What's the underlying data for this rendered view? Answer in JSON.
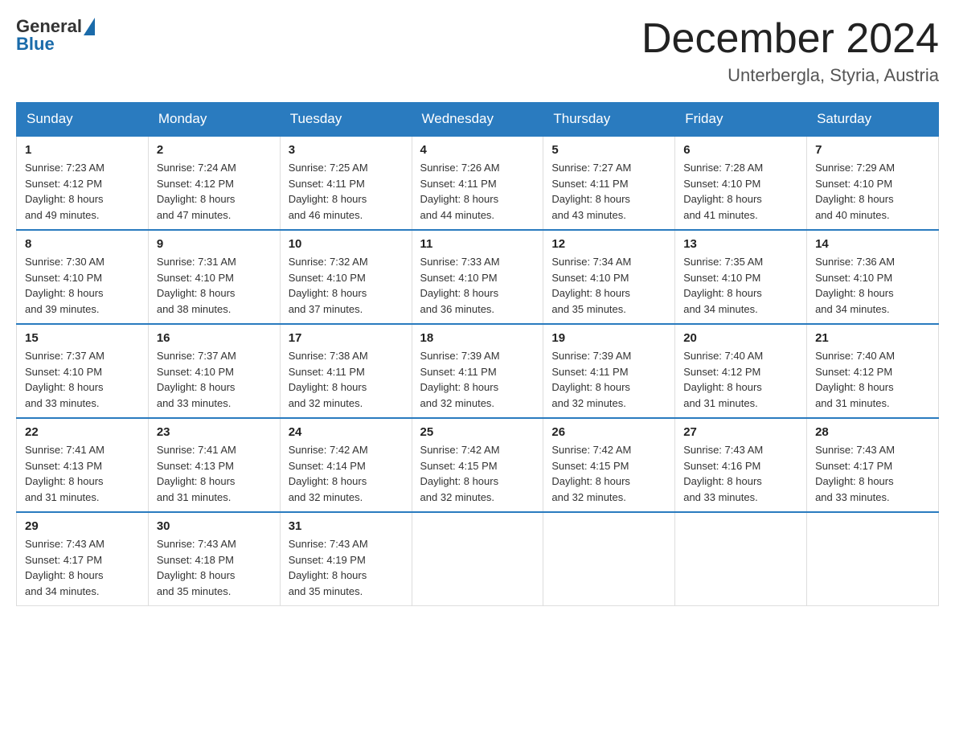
{
  "header": {
    "logo_general": "General",
    "logo_blue": "Blue",
    "month_title": "December 2024",
    "location": "Unterbergla, Styria, Austria"
  },
  "weekdays": [
    "Sunday",
    "Monday",
    "Tuesday",
    "Wednesday",
    "Thursday",
    "Friday",
    "Saturday"
  ],
  "weeks": [
    [
      {
        "day": "1",
        "sunrise": "7:23 AM",
        "sunset": "4:12 PM",
        "daylight": "8 hours and 49 minutes."
      },
      {
        "day": "2",
        "sunrise": "7:24 AM",
        "sunset": "4:12 PM",
        "daylight": "8 hours and 47 minutes."
      },
      {
        "day": "3",
        "sunrise": "7:25 AM",
        "sunset": "4:11 PM",
        "daylight": "8 hours and 46 minutes."
      },
      {
        "day": "4",
        "sunrise": "7:26 AM",
        "sunset": "4:11 PM",
        "daylight": "8 hours and 44 minutes."
      },
      {
        "day": "5",
        "sunrise": "7:27 AM",
        "sunset": "4:11 PM",
        "daylight": "8 hours and 43 minutes."
      },
      {
        "day": "6",
        "sunrise": "7:28 AM",
        "sunset": "4:10 PM",
        "daylight": "8 hours and 41 minutes."
      },
      {
        "day": "7",
        "sunrise": "7:29 AM",
        "sunset": "4:10 PM",
        "daylight": "8 hours and 40 minutes."
      }
    ],
    [
      {
        "day": "8",
        "sunrise": "7:30 AM",
        "sunset": "4:10 PM",
        "daylight": "8 hours and 39 minutes."
      },
      {
        "day": "9",
        "sunrise": "7:31 AM",
        "sunset": "4:10 PM",
        "daylight": "8 hours and 38 minutes."
      },
      {
        "day": "10",
        "sunrise": "7:32 AM",
        "sunset": "4:10 PM",
        "daylight": "8 hours and 37 minutes."
      },
      {
        "day": "11",
        "sunrise": "7:33 AM",
        "sunset": "4:10 PM",
        "daylight": "8 hours and 36 minutes."
      },
      {
        "day": "12",
        "sunrise": "7:34 AM",
        "sunset": "4:10 PM",
        "daylight": "8 hours and 35 minutes."
      },
      {
        "day": "13",
        "sunrise": "7:35 AM",
        "sunset": "4:10 PM",
        "daylight": "8 hours and 34 minutes."
      },
      {
        "day": "14",
        "sunrise": "7:36 AM",
        "sunset": "4:10 PM",
        "daylight": "8 hours and 34 minutes."
      }
    ],
    [
      {
        "day": "15",
        "sunrise": "7:37 AM",
        "sunset": "4:10 PM",
        "daylight": "8 hours and 33 minutes."
      },
      {
        "day": "16",
        "sunrise": "7:37 AM",
        "sunset": "4:10 PM",
        "daylight": "8 hours and 33 minutes."
      },
      {
        "day": "17",
        "sunrise": "7:38 AM",
        "sunset": "4:11 PM",
        "daylight": "8 hours and 32 minutes."
      },
      {
        "day": "18",
        "sunrise": "7:39 AM",
        "sunset": "4:11 PM",
        "daylight": "8 hours and 32 minutes."
      },
      {
        "day": "19",
        "sunrise": "7:39 AM",
        "sunset": "4:11 PM",
        "daylight": "8 hours and 32 minutes."
      },
      {
        "day": "20",
        "sunrise": "7:40 AM",
        "sunset": "4:12 PM",
        "daylight": "8 hours and 31 minutes."
      },
      {
        "day": "21",
        "sunrise": "7:40 AM",
        "sunset": "4:12 PM",
        "daylight": "8 hours and 31 minutes."
      }
    ],
    [
      {
        "day": "22",
        "sunrise": "7:41 AM",
        "sunset": "4:13 PM",
        "daylight": "8 hours and 31 minutes."
      },
      {
        "day": "23",
        "sunrise": "7:41 AM",
        "sunset": "4:13 PM",
        "daylight": "8 hours and 31 minutes."
      },
      {
        "day": "24",
        "sunrise": "7:42 AM",
        "sunset": "4:14 PM",
        "daylight": "8 hours and 32 minutes."
      },
      {
        "day": "25",
        "sunrise": "7:42 AM",
        "sunset": "4:15 PM",
        "daylight": "8 hours and 32 minutes."
      },
      {
        "day": "26",
        "sunrise": "7:42 AM",
        "sunset": "4:15 PM",
        "daylight": "8 hours and 32 minutes."
      },
      {
        "day": "27",
        "sunrise": "7:43 AM",
        "sunset": "4:16 PM",
        "daylight": "8 hours and 33 minutes."
      },
      {
        "day": "28",
        "sunrise": "7:43 AM",
        "sunset": "4:17 PM",
        "daylight": "8 hours and 33 minutes."
      }
    ],
    [
      {
        "day": "29",
        "sunrise": "7:43 AM",
        "sunset": "4:17 PM",
        "daylight": "8 hours and 34 minutes."
      },
      {
        "day": "30",
        "sunrise": "7:43 AM",
        "sunset": "4:18 PM",
        "daylight": "8 hours and 35 minutes."
      },
      {
        "day": "31",
        "sunrise": "7:43 AM",
        "sunset": "4:19 PM",
        "daylight": "8 hours and 35 minutes."
      },
      null,
      null,
      null,
      null
    ]
  ],
  "labels": {
    "sunrise": "Sunrise:",
    "sunset": "Sunset:",
    "daylight": "Daylight:"
  }
}
